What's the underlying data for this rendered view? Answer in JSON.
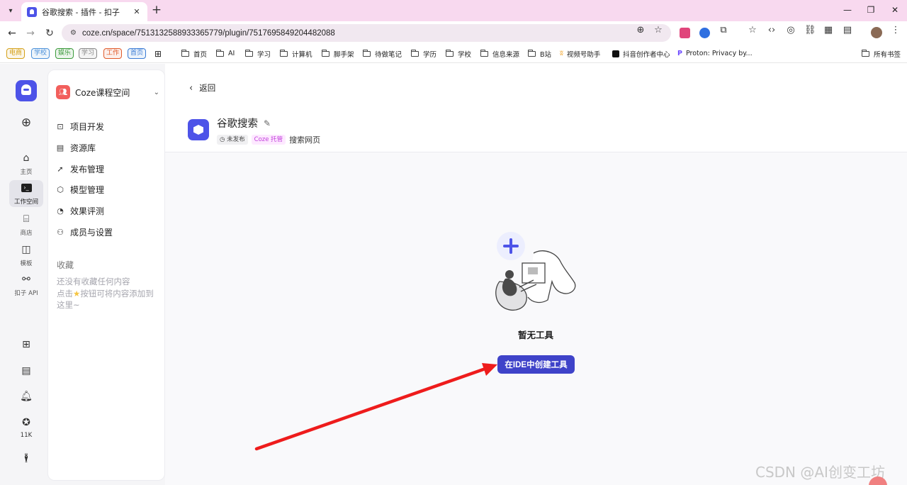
{
  "browser": {
    "tab_title": "谷歌搜索 - 插件 - 扣子",
    "new_tab_label": "+",
    "url": "coze.cn/space/7513132588933365779/plugin/7517695849204482088",
    "bookmark_tags": [
      {
        "label": "电商",
        "color": "#d4a017"
      },
      {
        "label": "学校",
        "color": "#4a90d9"
      },
      {
        "label": "娱乐",
        "color": "#3a9a3a"
      },
      {
        "label": "学习",
        "color": "#888888"
      },
      {
        "label": "工作",
        "color": "#e05a2a"
      },
      {
        "label": "首页",
        "color": "#3a7bd5"
      }
    ],
    "bookmark_folders": [
      "首页",
      "AI",
      "学习",
      "计算机",
      "脚手架",
      "待做笔记",
      "学历",
      "学校",
      "信息来源",
      "B站"
    ],
    "bookmark_links": [
      "视频号助手",
      "抖音创作者中心",
      "Proton: Privacy by..."
    ],
    "all_bookmarks": "所有书签"
  },
  "rail": {
    "items": [
      {
        "label": "主页"
      },
      {
        "label": "工作空间"
      },
      {
        "label": "商店"
      },
      {
        "label": "模板"
      },
      {
        "label": "扣子 API"
      }
    ],
    "star_count": "11K"
  },
  "sidebar": {
    "space_name": "Coze课程空间",
    "menu": [
      {
        "label": "项目开发"
      },
      {
        "label": "资源库"
      },
      {
        "label": "发布管理"
      },
      {
        "label": "模型管理"
      },
      {
        "label": "效果评测"
      },
      {
        "label": "成员与设置"
      }
    ],
    "favorites_title": "收藏",
    "favorites_empty_1": "还没有收藏任何内容",
    "favorites_empty_2a": "点击",
    "favorites_empty_2b": "按钮可将内容添加到",
    "favorites_empty_3": "这里~"
  },
  "main": {
    "back_label": "返回",
    "plugin_name": "谷歌搜索",
    "status_badge": "未发布",
    "hosting_badge": "Coze 托管",
    "description": "搜索网页",
    "empty_text": "暂无工具",
    "create_button": "在IDE中创建工具"
  },
  "annotation": {
    "arrow_color": "#ee1c1c"
  },
  "watermark": "CSDN @AI创变工坊"
}
